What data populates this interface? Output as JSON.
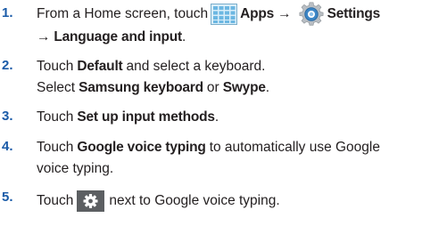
{
  "steps": [
    {
      "num": "1.",
      "pre": "From a Home screen, touch",
      "apps": "Apps",
      "arrow": "→",
      "settings": "Settings",
      "arrow2": "→",
      "lang": "Language and input",
      "end": "."
    },
    {
      "num": "2.",
      "pre": "Touch",
      "default": "Default",
      "post": "and select a keyboard.",
      "select": "Select",
      "samsung": "Samsung keyboard",
      "or": "or",
      "swype": "Swype",
      "end": "."
    },
    {
      "num": "3.",
      "pre": "Touch",
      "setup": "Set up input methods",
      "end": "."
    },
    {
      "num": "4.",
      "pre": "Touch",
      "gvt": "Google voice typing",
      "post": "to automatically use Google",
      "line2": "voice typing."
    },
    {
      "num": "5.",
      "pre": "Touch",
      "post": "next to Google voice typing."
    }
  ],
  "icons": {
    "apps": "apps-grid-icon",
    "settings": "settings-gear-icon",
    "gear": "gear-button-icon"
  },
  "colors": {
    "number": "#1a5ba8",
    "text": "#231f20",
    "apps_icon": "#7cc3e8",
    "gear_button": "#5c5f62"
  }
}
